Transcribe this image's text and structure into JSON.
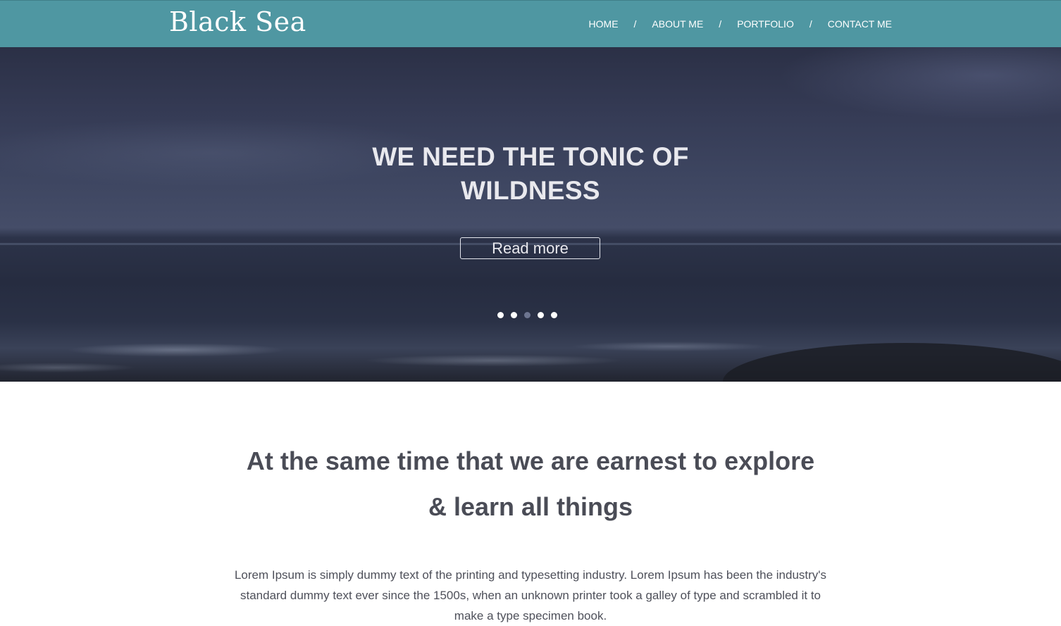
{
  "header": {
    "logo": "Black Sea",
    "nav": [
      {
        "label": "HOME"
      },
      {
        "label": "ABOUT ME"
      },
      {
        "label": "PORTFOLIO"
      },
      {
        "label": "CONTACT ME"
      }
    ],
    "separator": "/",
    "background_color": "#4f97a2"
  },
  "hero": {
    "title_line1": "WE NEED THE TONIC OF",
    "title_line2": "WILDNESS",
    "button_label": "Read more",
    "carousel": {
      "slide_count": 5,
      "active_index": 2
    }
  },
  "content": {
    "headline_line1": "At the same time that we are earnest to explore",
    "headline_line2": "& learn all things",
    "paragraph": "Lorem Ipsum is simply dummy text of the printing and typesetting industry. Lorem Ipsum has been the industry's standard dummy text ever since the 1500s, when an unknown printer took a galley of type and scrambled it to make a type specimen book."
  }
}
